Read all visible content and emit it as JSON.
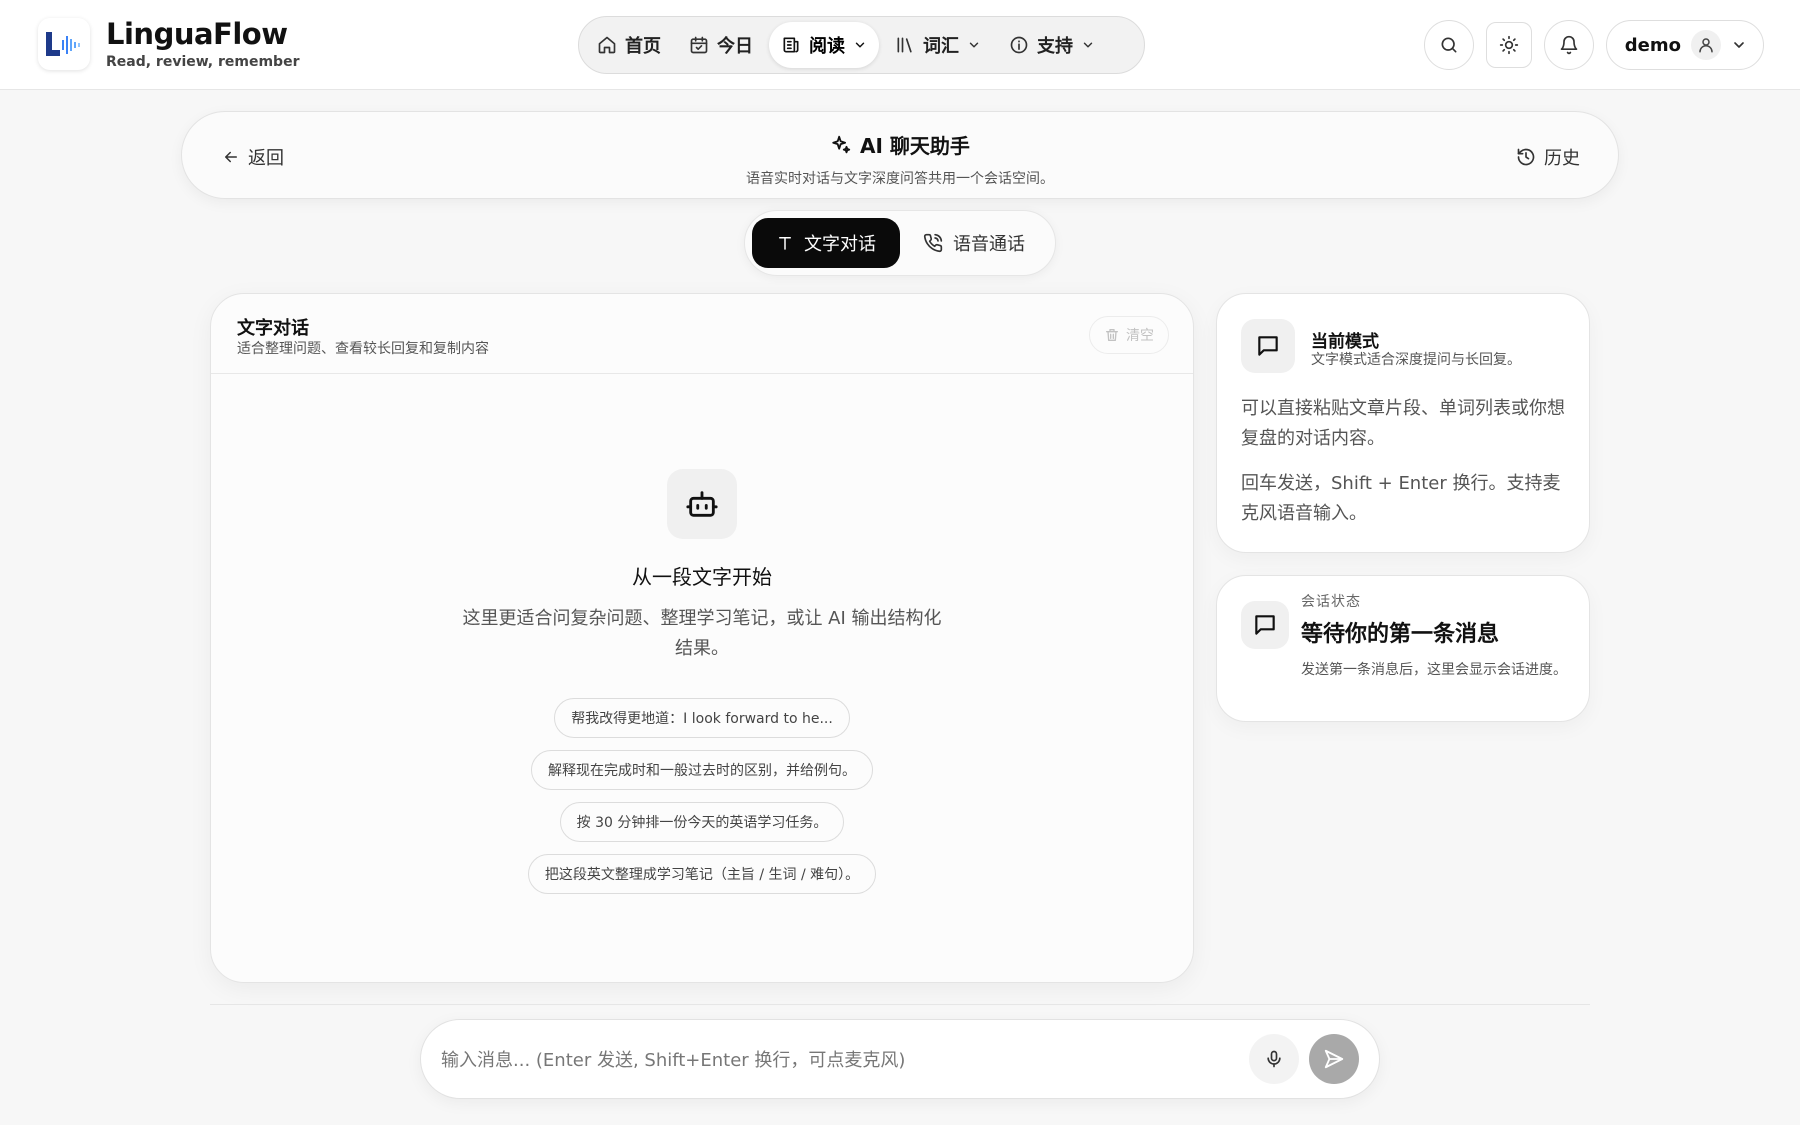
{
  "app": {
    "name": "LinguaFlow",
    "tagline": "Read, review, remember",
    "accent_color": "#1e3a8a"
  },
  "nav": {
    "items": [
      {
        "label": "首页",
        "icon": "home-icon"
      },
      {
        "label": "今日",
        "icon": "calendar-check-icon"
      },
      {
        "label": "阅读",
        "icon": "newspaper-icon",
        "active": true
      },
      {
        "label": "词汇",
        "icon": "library-icon"
      },
      {
        "label": "支持",
        "icon": "info-icon"
      }
    ]
  },
  "header": {
    "user_name": "demo",
    "icons": [
      "search-icon",
      "sun-icon",
      "bell-icon",
      "user-icon",
      "chevron-down-icon"
    ]
  },
  "titlebar": {
    "back_label": "返回",
    "title": "AI 聊天助手",
    "subtitle": "语音实时对话与文字深度问答共用一个会话空间。",
    "history_label": "历史"
  },
  "mode_toggle": {
    "text_label": "文字对话",
    "voice_label": "语音通话",
    "selected": "text"
  },
  "chat": {
    "title": "文字对话",
    "subtitle": "适合整理问题、查看较长回复和复制内容",
    "clear_label": "清空",
    "empty_title": "从一段文字开始",
    "empty_desc": "这里更适合问复杂问题、整理学习笔记，或让 AI 输出结构化结果。",
    "suggestions": [
      "帮我改得更地道：I look forward to he...",
      "解释现在完成时和一般过去时的区别，并给例句。",
      "按 30 分钟排一份今天的英语学习任务。",
      "把这段英文整理成学习笔记（主旨 / 生词 / 难句）。"
    ]
  },
  "mode_card": {
    "title": "当前模式",
    "subtitle": "文字模式适合深度提问与长回复。",
    "p1": "可以直接粘贴文章片段、单词列表或你想复盘的对话内容。",
    "p2": "回车发送，Shift + Enter 换行。支持麦克风语音输入。"
  },
  "status_card": {
    "key": "会话状态",
    "value": "等待你的第一条消息",
    "desc": "发送第一条消息后，这里会显示会话进度。"
  },
  "composer": {
    "placeholder": "输入消息... (Enter 发送, Shift+Enter 换行，可点麦克风)",
    "value": ""
  }
}
